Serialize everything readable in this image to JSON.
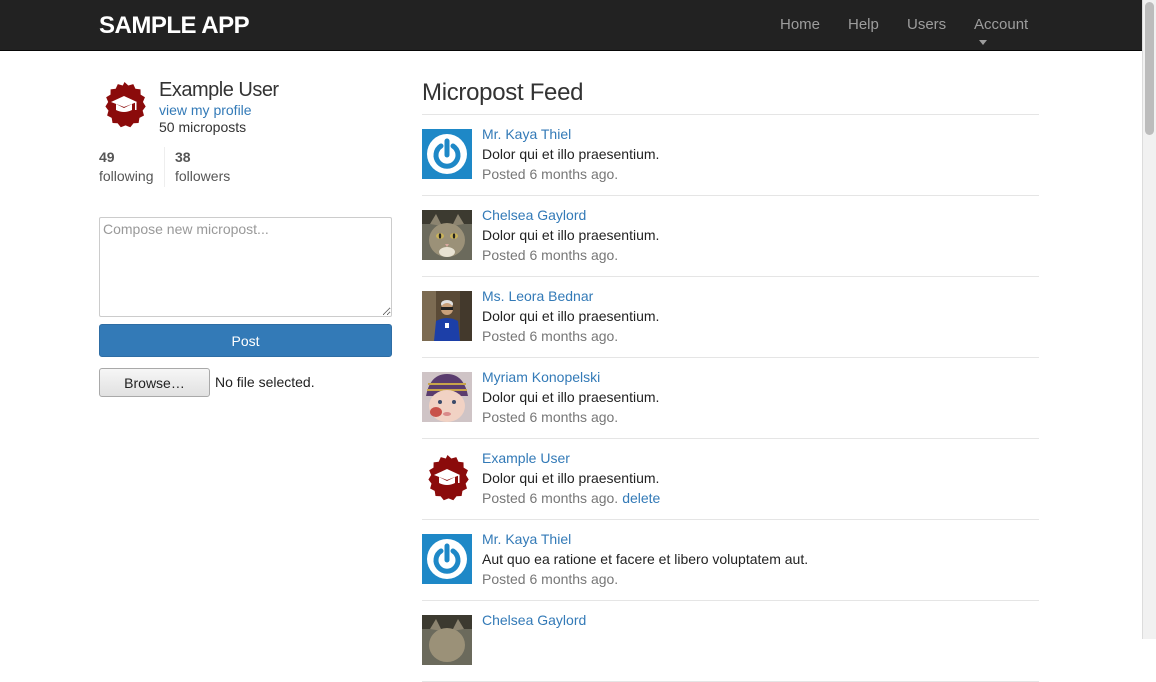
{
  "navbar": {
    "brand": "SAMPLE APP",
    "links": [
      "Home",
      "Help",
      "Users"
    ],
    "account_label": "Account"
  },
  "sidebar": {
    "user_name": "Example User",
    "profile_link": "view my profile",
    "micropost_count": "50 microposts",
    "stats": {
      "following_count": "49",
      "following_label": "following",
      "followers_count": "38",
      "followers_label": "followers"
    },
    "compose_placeholder": "Compose new micropost...",
    "post_button": "Post",
    "browse_button": "Browse…",
    "file_status": "No file selected."
  },
  "feed": {
    "title": "Micropost Feed",
    "items": [
      {
        "user": "Mr. Kaya Thiel",
        "content": "Dolor qui et illo praesentium.",
        "time": "Posted 6 months ago.",
        "avatar": "power-icon-avatar"
      },
      {
        "user": "Chelsea Gaylord",
        "content": "Dolor qui et illo praesentium.",
        "time": "Posted 6 months ago.",
        "avatar": "cat-photo-avatar"
      },
      {
        "user": "Ms. Leora Bednar",
        "content": "Dolor qui et illo praesentium.",
        "time": "Posted 6 months ago.",
        "avatar": "person-photo-avatar"
      },
      {
        "user": "Myriam Konopelski",
        "content": "Dolor qui et illo praesentium.",
        "time": "Posted 6 months ago.",
        "avatar": "baby-photo-avatar"
      },
      {
        "user": "Example User",
        "content": "Dolor qui et illo praesentium.",
        "time": "Posted 6 months ago.",
        "delete": "delete",
        "avatar": "graduation-badge-avatar"
      },
      {
        "user": "Mr. Kaya Thiel",
        "content": "Aut quo ea ratione et facere et libero voluptatem aut.",
        "time": "Posted 6 months ago.",
        "avatar": "power-icon-avatar"
      },
      {
        "user": "Chelsea Gaylord",
        "content": "",
        "time": "",
        "avatar": "cat-photo-avatar"
      }
    ]
  },
  "colors": {
    "navbar_bg": "#222222",
    "link": "#337ab7",
    "primary_button": "#337ab7",
    "badge_red": "#8b0b0b"
  }
}
